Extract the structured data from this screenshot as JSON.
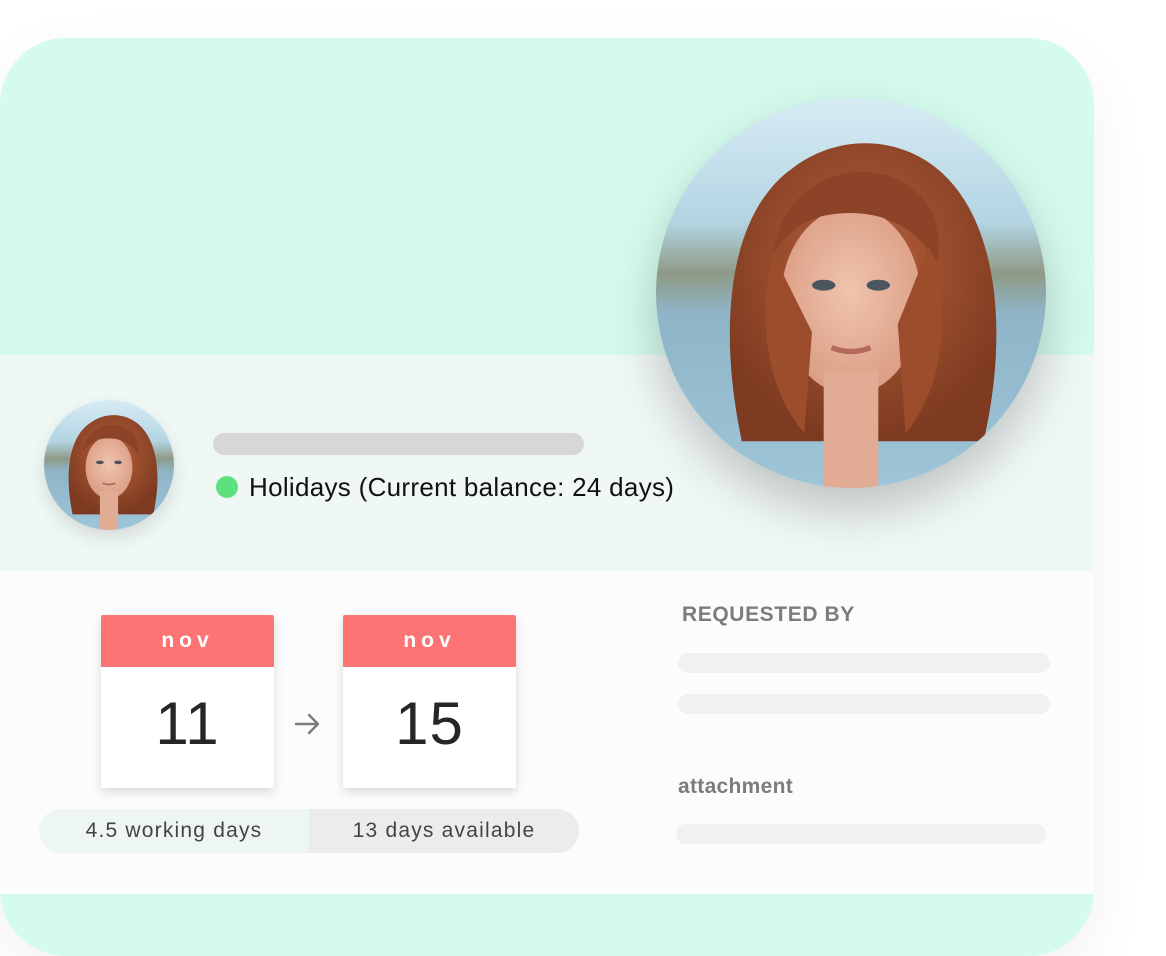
{
  "request": {
    "leave_type_label": "Holidays (Current balance: 24 days)",
    "status_color": "#5ee07e"
  },
  "dates": {
    "start": {
      "month": "nov",
      "day": "11"
    },
    "end": {
      "month": "nov",
      "day": "15"
    }
  },
  "summary": {
    "working_days": "4.5 working days",
    "days_available": "13 days available"
  },
  "details": {
    "requested_by_heading": "REQUESTED BY",
    "attachment_heading": "attachment"
  },
  "icons": {
    "date_arrow": "arrow-right-icon"
  },
  "colors": {
    "header_mint": "#d5fbef",
    "month_banner": "#fd7474",
    "status_dot": "#5ee07e"
  }
}
